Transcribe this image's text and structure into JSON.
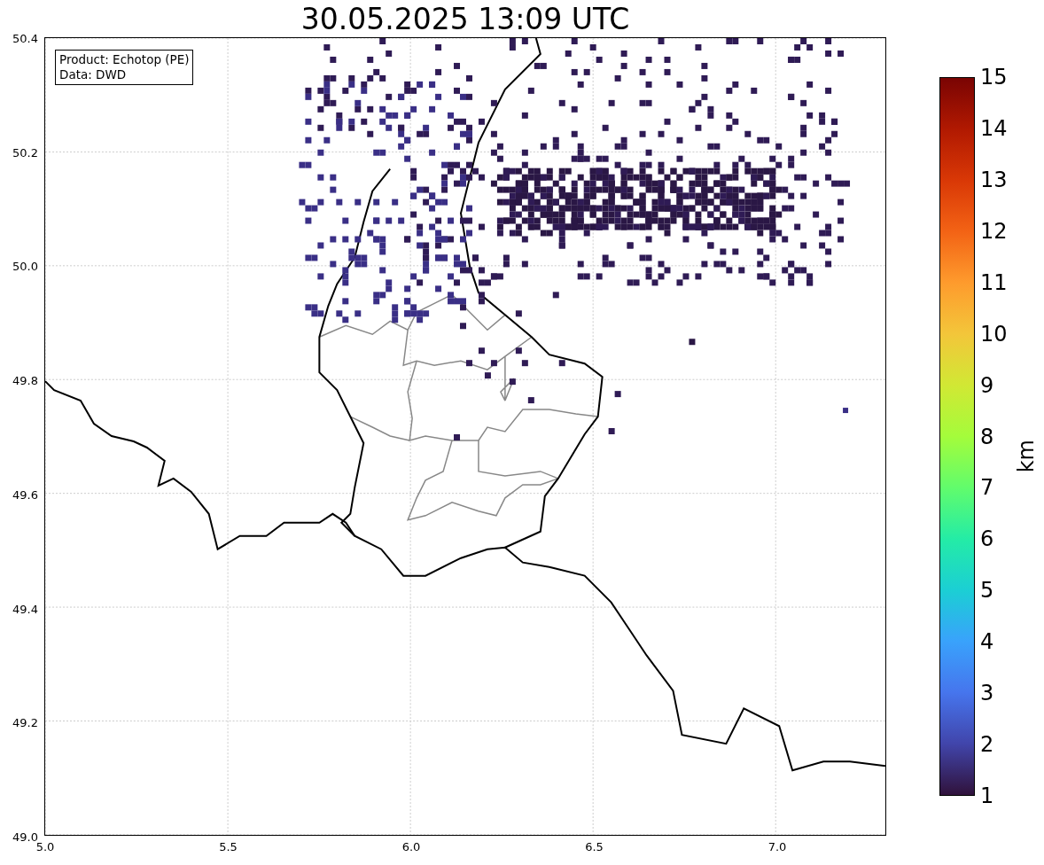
{
  "title": "30.05.2025 13:09 UTC",
  "legend": {
    "lines": [
      "Product: Echotop (PE)",
      "Data: DWD"
    ]
  },
  "map": {
    "x_ticks": [
      "5.0",
      "5.5",
      "6.0",
      "6.5",
      "7.0"
    ],
    "y_ticks": [
      "50.4",
      "50.2",
      "50.0",
      "49.8",
      "49.6",
      "49.4",
      "49.2",
      "49.0"
    ]
  },
  "colorbar": {
    "label": "km",
    "ticks": [
      "15",
      "14",
      "13",
      "12",
      "11",
      "10",
      "9",
      "8",
      "7",
      "6",
      "5",
      "4",
      "3",
      "2",
      "1"
    ]
  }
}
